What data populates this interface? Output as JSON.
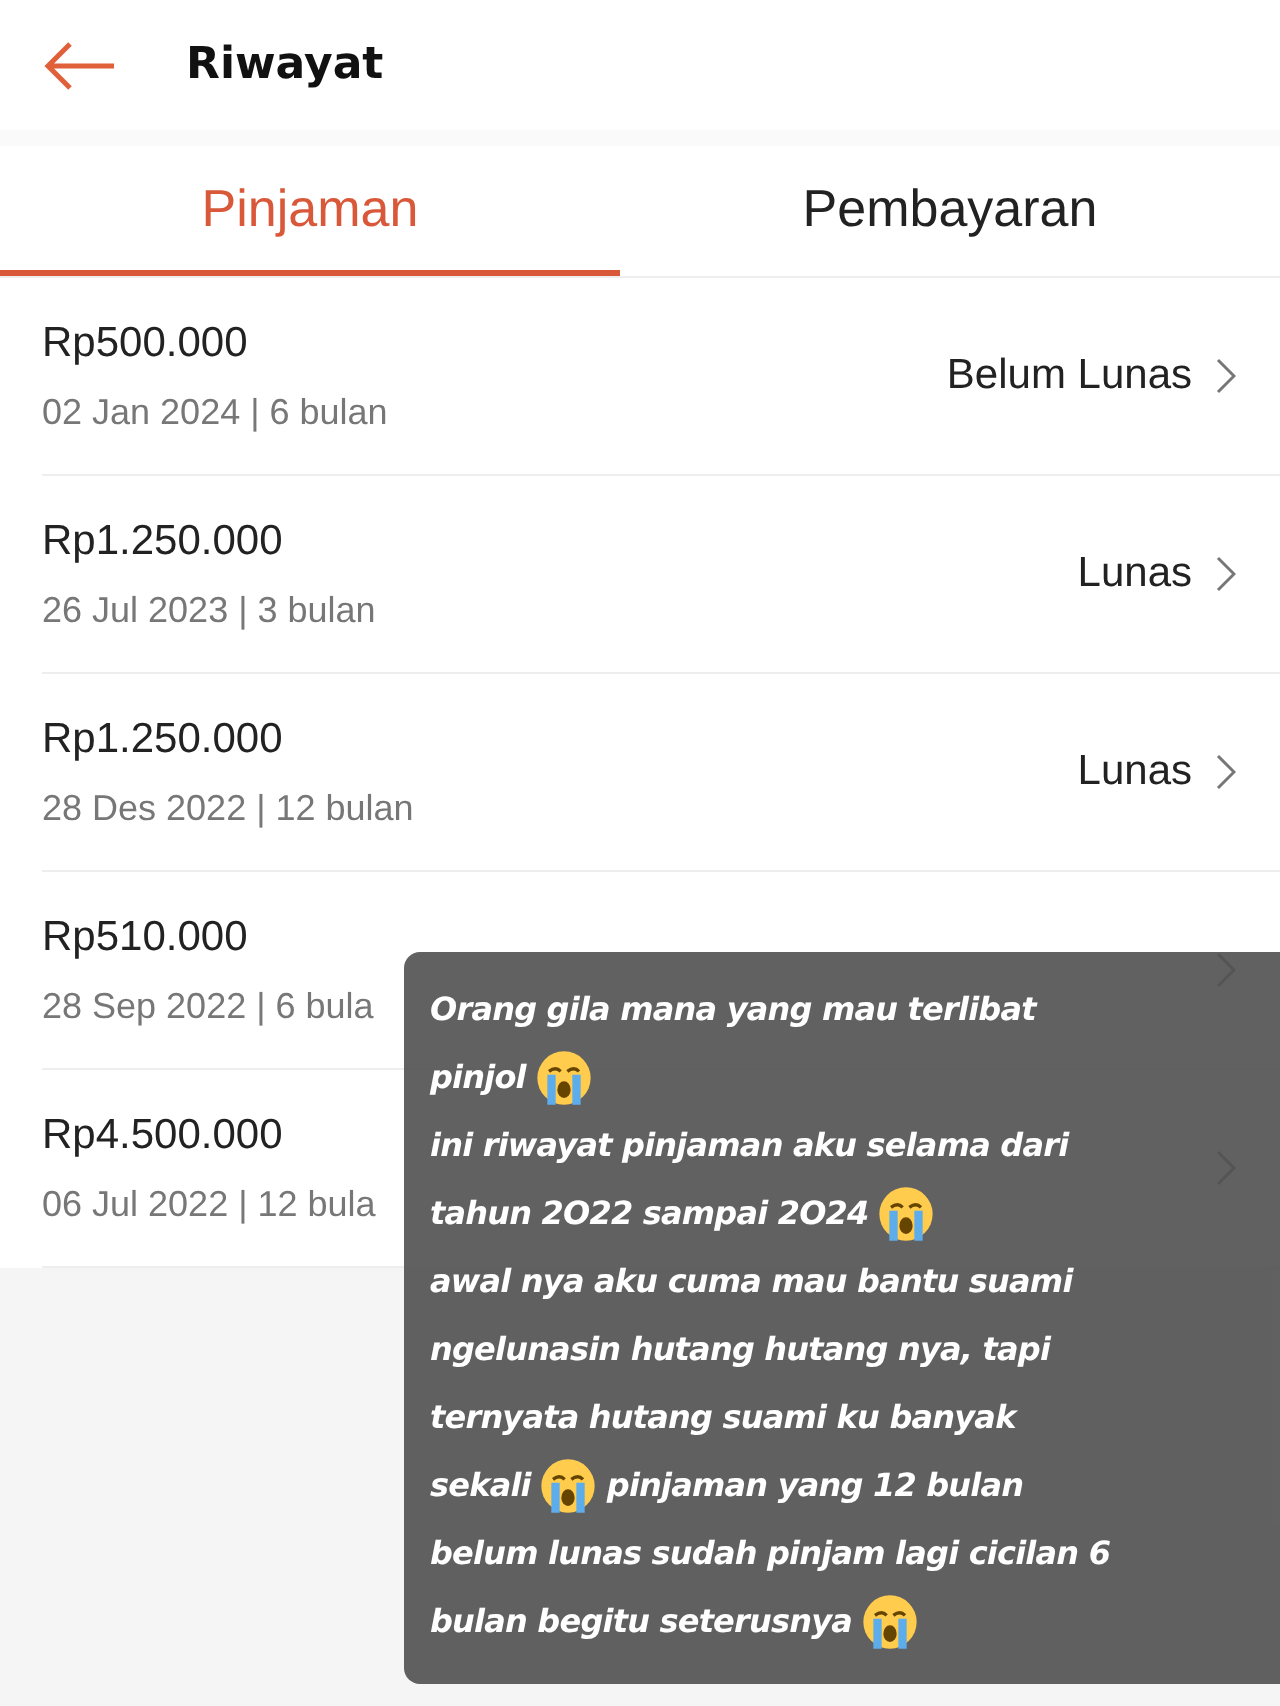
{
  "header": {
    "title": "Riwayat"
  },
  "tabs": [
    {
      "label": "Pinjaman",
      "selected": true
    },
    {
      "label": "Pembayaran",
      "selected": false
    }
  ],
  "loans": [
    {
      "amount": "Rp500.000",
      "detail": "02 Jan 2024 | 6 bulan",
      "status": "Belum Lunas"
    },
    {
      "amount": "Rp1.250.000",
      "detail": "26 Jul 2023 | 3 bulan",
      "status": "Lunas"
    },
    {
      "amount": "Rp1.250.000",
      "detail": "28 Des 2022 | 12 bulan",
      "status": "Lunas"
    },
    {
      "amount": "Rp510.000",
      "detail": "28 Sep 2022 | 6 bula"
    },
    {
      "amount": "Rp4.500.000",
      "detail": "06 Jul 2022 | 12 bula"
    }
  ],
  "caption": {
    "lines": [
      [
        {
          "kind": "text",
          "text": "Orang gila mana yang mau terlibat"
        }
      ],
      [
        {
          "kind": "text",
          "text": "pinjol"
        },
        {
          "kind": "emoji"
        }
      ],
      [
        {
          "kind": "text",
          "text": "ini riwayat pinjaman aku selama dari"
        }
      ],
      [
        {
          "kind": "text",
          "text": "tahun 2O22 sampai 2O24"
        },
        {
          "kind": "emoji"
        }
      ],
      [
        {
          "kind": "text",
          "text": "awal nya aku cuma mau bantu suami"
        }
      ],
      [
        {
          "kind": "text",
          "text": "ngelunasin hutang hutang nya, tapi"
        }
      ],
      [
        {
          "kind": "text",
          "text": "ternyata hutang suami ku banyak"
        }
      ],
      [
        {
          "kind": "text",
          "text": "sekali"
        },
        {
          "kind": "emoji"
        },
        {
          "kind": "text",
          "text": "pinjaman yang 12 bulan"
        }
      ],
      [
        {
          "kind": "text",
          "text": "belum lunas sudah pinjam lagi cicilan 6"
        }
      ],
      [
        {
          "kind": "text",
          "text": "bulan begitu seterusnya"
        },
        {
          "kind": "emoji"
        }
      ]
    ]
  }
}
